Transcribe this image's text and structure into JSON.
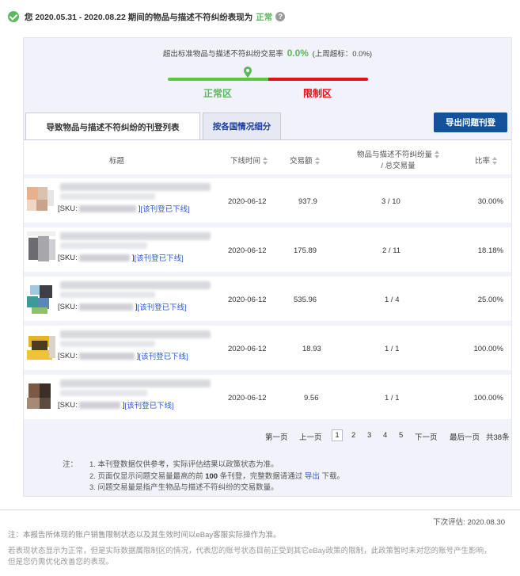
{
  "header": {
    "text": "您 2020.05.31 - 2020.08.22 期间的物品与描述不符纠纷表现为",
    "status": "正常",
    "help_glyph": "?"
  },
  "summary": {
    "rate_label": "超出标准物品与描述不符纠纷交易率",
    "rate_value": "0.0%",
    "prev_label": "(上周超标：0.0%)",
    "zone_normal": "正常区",
    "zone_limited": "限制区",
    "colors": {
      "normal": "#5cb85c",
      "limited": "#e0101c"
    }
  },
  "tabs": [
    {
      "label": "导致物品与描述不符纠纷的刊登列表",
      "active": true
    },
    {
      "label": "按各国情况细分",
      "active": false
    }
  ],
  "export_label": "导出问题刊登",
  "table": {
    "headers": {
      "title": "标题",
      "date": "下线时间",
      "amount": "交易额",
      "count_line1": "物品与描述不符纠纷量",
      "count_line2": "/ 总交易量",
      "ratio": "比率"
    },
    "rows": [
      {
        "sku_prefix": "[SKU: ",
        "sku_suffix": "]",
        "status": "[该刊登已下线]",
        "date": "2020-06-12",
        "amount": "937.9",
        "count": "3 / 10",
        "ratio": "30.00%"
      },
      {
        "sku_prefix": "[SKU: ",
        "sku_suffix": "]",
        "status": "[该刊登已下线]",
        "date": "2020-06-12",
        "amount": "175.89",
        "count": "2 / 11",
        "ratio": "18.18%"
      },
      {
        "sku_prefix": "[SKU: ",
        "sku_suffix": "]",
        "status": "[该刊登已下线]",
        "date": "2020-06-12",
        "amount": "535.96",
        "count": "1 / 4",
        "ratio": "25.00%"
      },
      {
        "sku_prefix": "[SKU: ",
        "sku_suffix": "]",
        "status": "[该刊登已下线]",
        "date": "2020-06-12",
        "amount": "18.93",
        "count": "1 / 1",
        "ratio": "100.00%"
      },
      {
        "sku_prefix": "[SKU: ",
        "sku_suffix": "]",
        "status": "[该刊登已下线]",
        "date": "2020-06-12",
        "amount": "9.56",
        "count": "1 / 1",
        "ratio": "100.00%"
      }
    ]
  },
  "pagination": {
    "first": "第一页",
    "prev": "上一页",
    "pages": [
      "1",
      "2",
      "3",
      "4",
      "5"
    ],
    "current": "1",
    "next": "下一页",
    "last": "最后一页",
    "total": "共38条"
  },
  "notes": {
    "label": "注：",
    "n1": "1.  本刊登数据仅供参考，实际评估结果以政策状态为准。",
    "n2_a": "2.  页面仅显示问题交易量最高的前 ",
    "n2_b": "100",
    "n2_c": " 条刊登，完整数据请通过 ",
    "n2_link": "导出",
    "n2_d": " 下载。",
    "n3": "3.  问题交易量是指产生物品与描述不符纠纷的交易数量。"
  },
  "footer": {
    "next_eval": "下次评估: 2020.08.30",
    "note": "注：本报告所体现的账户销售限制状态以及其生效时间以eBay客服实际操作为准。",
    "para_1": "若表现状态显示为正常，但是实际数据属限制区的情况，代表您的账号状态目前正受到其它eBay政策的限制，此政策暂时未对您的账号产生影响，",
    "para_2": "但是您仍需优化改善您的表现。"
  }
}
